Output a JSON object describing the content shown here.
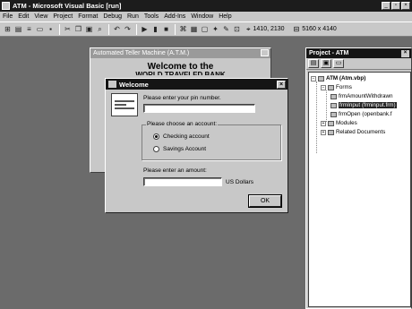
{
  "window": {
    "title": "ATM - Microsoft Visual Basic [run]"
  },
  "menu": [
    "File",
    "Edit",
    "View",
    "Project",
    "Format",
    "Debug",
    "Run",
    "Tools",
    "Add-Ins",
    "Window",
    "Help"
  ],
  "toolbar": {
    "position": "1410, 2130",
    "size": "5160 x 4140"
  },
  "atm_form": {
    "title": "Automated Teller Machine (A.T.M.)",
    "heading": "Welcome to the",
    "bank": "WORLD TRAVELED BANK"
  },
  "dialog": {
    "title": "Welcome",
    "pin_label": "Please enter your pin number.",
    "pin_value": "",
    "account_label": "Please choose an account:",
    "checking_label": "Checking account",
    "savings_label": "Savings Account",
    "amount_label": "Please enter an amount:",
    "amount_value": "",
    "units": "US Dollars",
    "ok_label": "OK"
  },
  "project": {
    "title": "Project - ATM",
    "root": "ATM (Atm.vbp)",
    "forms_label": "Forms",
    "forms": [
      "frmAmountWithdrawn",
      "frmInput (frminput.frm)",
      "frmOpen (openbank.f"
    ],
    "modules_label": "Modules",
    "related_label": "Related Documents"
  }
}
